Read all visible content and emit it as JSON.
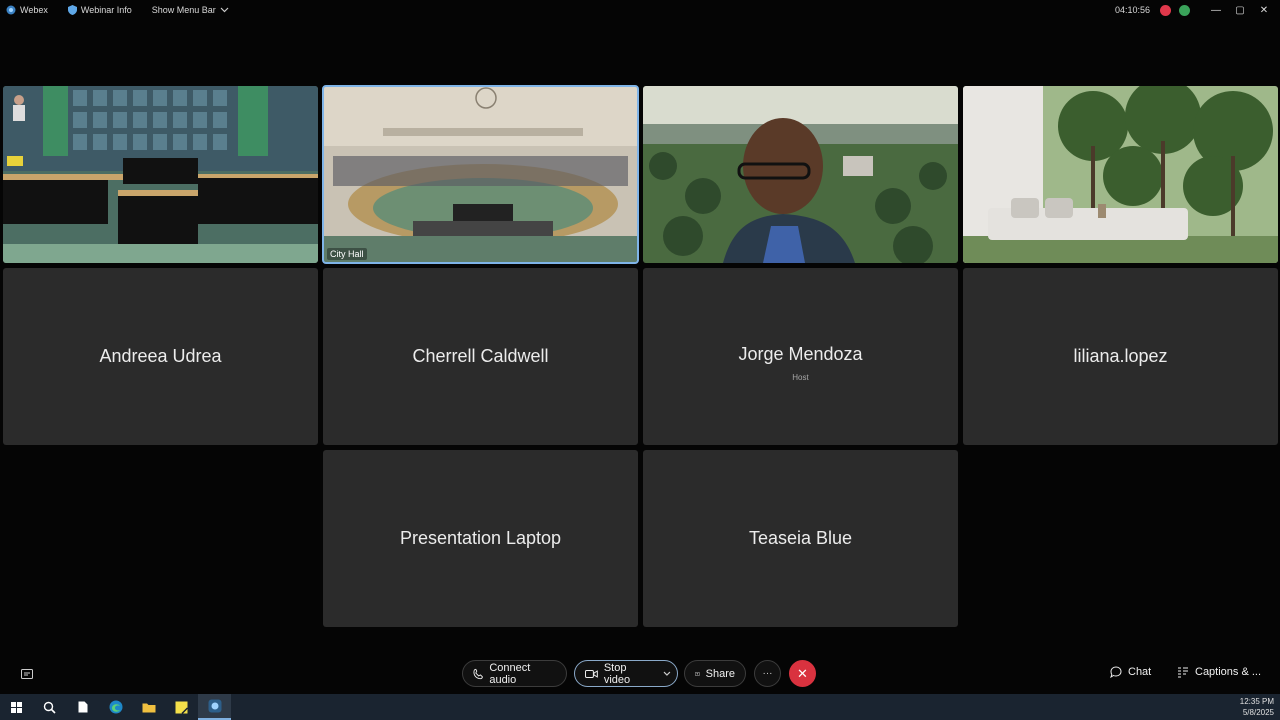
{
  "app": {
    "name": "Webex",
    "webinar_info": "Webinar Info",
    "show_menu_bar": "Show Menu Bar",
    "timer": "04:10:56"
  },
  "video_tiles": [
    {
      "label": ""
    },
    {
      "label": "City Hall"
    },
    {
      "label": ""
    },
    {
      "label": ""
    }
  ],
  "participants": [
    {
      "name": "Andreea Udrea",
      "role": ""
    },
    {
      "name": "Cherrell Caldwell",
      "role": ""
    },
    {
      "name": "Jorge Mendoza",
      "role": "Host"
    },
    {
      "name": "liliana.lopez",
      "role": ""
    },
    {
      "name": "Presentation Laptop",
      "role": ""
    },
    {
      "name": "Teaseia Blue",
      "role": ""
    }
  ],
  "controls": {
    "connect_audio": "Connect audio",
    "stop_video": "Stop video",
    "share": "Share",
    "more": "···",
    "leave": "✕",
    "chat": "Chat",
    "captions": "Captions & ..."
  },
  "taskbar": {
    "time": "12:35 PM",
    "date": "5/8/2025"
  },
  "colors": {
    "leave_red": "#d9323f",
    "active_tile_border": "#7fb4e8",
    "tile_bg": "#2b2b2b"
  }
}
